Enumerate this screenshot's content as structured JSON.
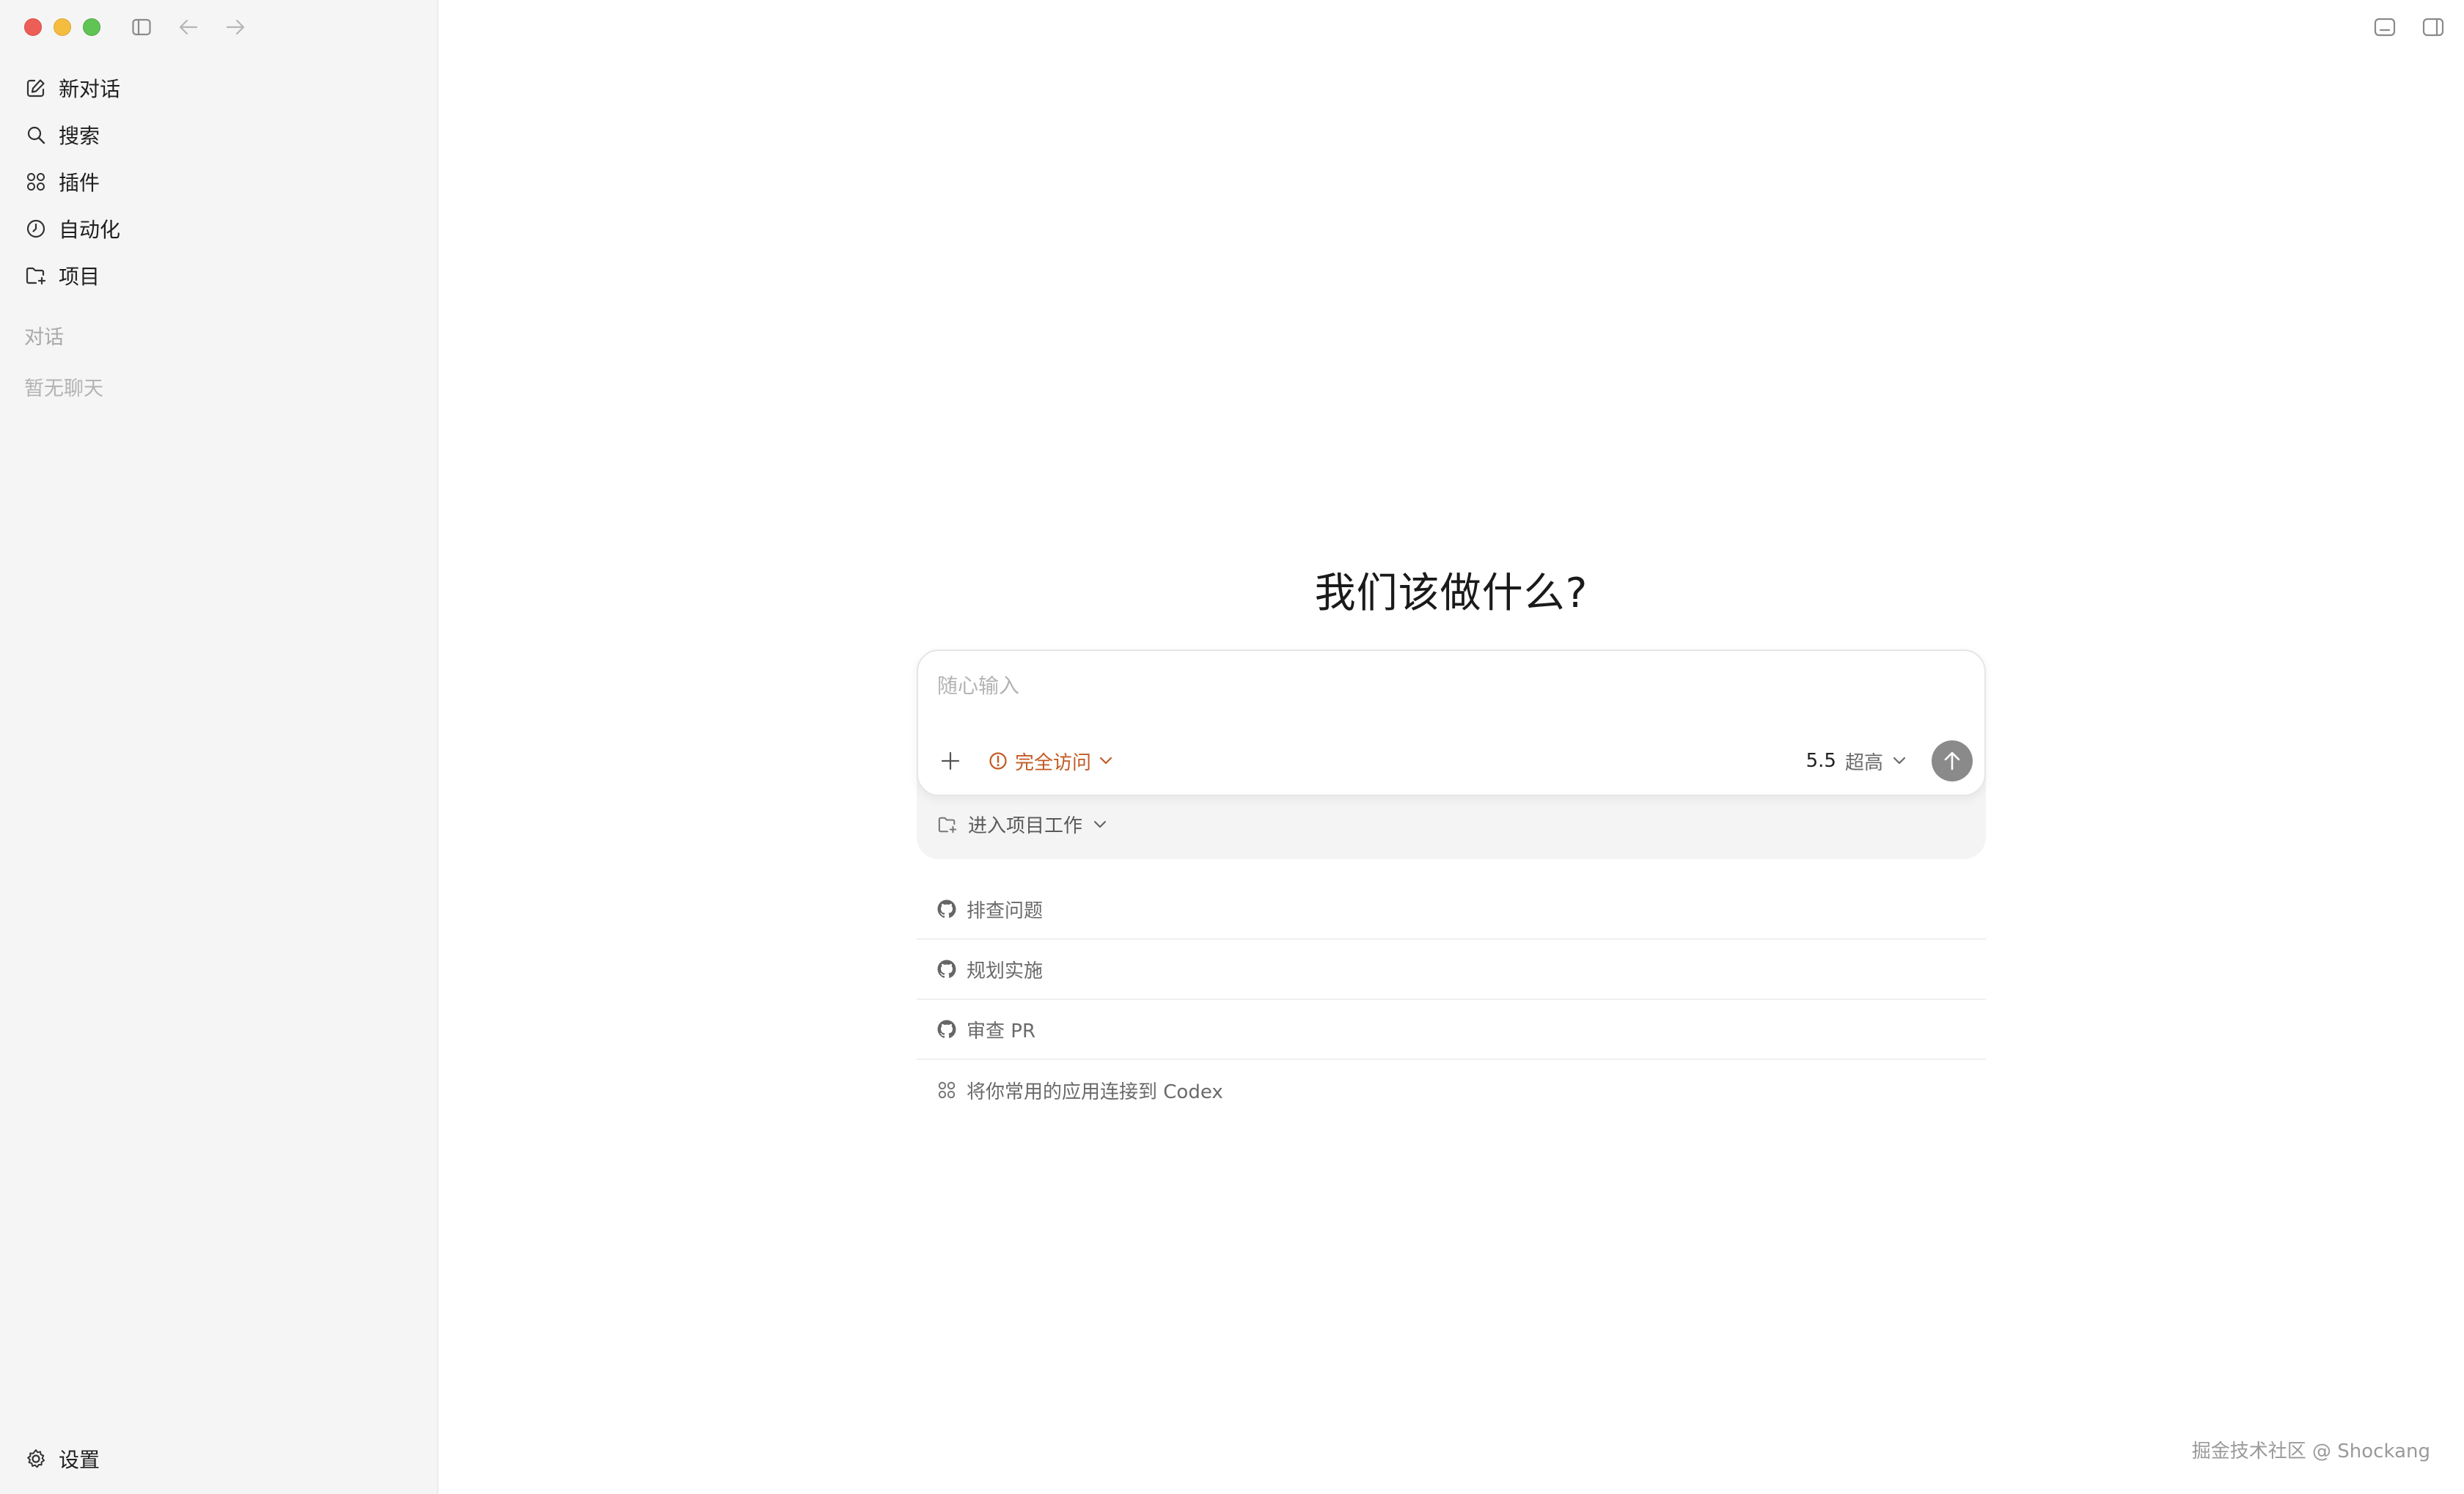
{
  "sidebar": {
    "window_controls": {
      "close_color": "#ee5e58",
      "minimize_color": "#f5bd3f",
      "maximize_color": "#5fc454"
    },
    "titlebar_icons": [
      "sidebar-toggle-icon",
      "arrow-left-icon",
      "arrow-right-icon"
    ],
    "nav_items": [
      {
        "icon": "edit-icon",
        "label": "新对话"
      },
      {
        "icon": "search-icon",
        "label": "搜索"
      },
      {
        "icon": "plugins-grid-icon",
        "label": "插件"
      },
      {
        "icon": "clock-icon",
        "label": "自动化"
      },
      {
        "icon": "folder-icon",
        "label": "项目"
      }
    ],
    "section_label": "对话",
    "empty_state": "暂无聊天",
    "settings": {
      "icon": "gear-icon",
      "label": "设置"
    }
  },
  "main": {
    "top_right_icons": [
      "terminal-panel-icon",
      "right-panel-icon"
    ],
    "heading": "我们该做什么?",
    "composer": {
      "placeholder": "随心输入",
      "access_label": "完全访问",
      "access_color": "#c25a23",
      "model_version": "5.5",
      "model_level": "超高"
    },
    "project_row_label": "进入项目工作",
    "suggestions": [
      {
        "icon": "github-icon",
        "label": "排查问题"
      },
      {
        "icon": "github-icon",
        "label": "规划实施"
      },
      {
        "icon": "github-icon",
        "label": "审查 PR"
      },
      {
        "icon": "apps-grid-icon",
        "label": "将你常用的应用连接到 Codex"
      }
    ]
  },
  "watermark": "掘金技术社区 @ Shockang"
}
